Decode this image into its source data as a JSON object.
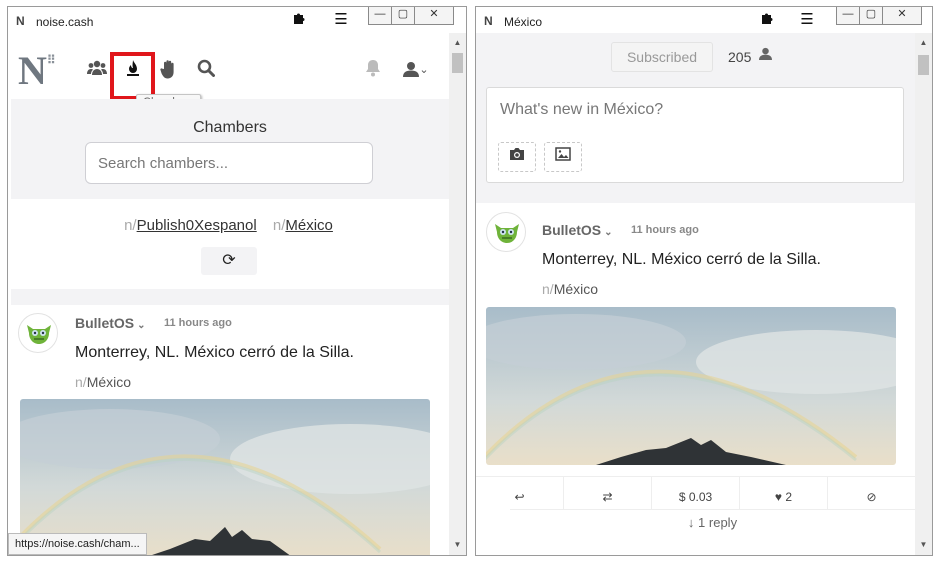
{
  "left_window": {
    "title": "noise.cash",
    "logo_char": "N",
    "extensions_icon": "puzzle-icon",
    "menu_glyph": "☰",
    "window_buttons": [
      "—",
      "▢",
      "✕"
    ],
    "nav": {
      "logo_text": "N",
      "tooltip": "Chambers",
      "icons": [
        "people-icon",
        "chambers-flame-icon",
        "hand-icon",
        "search-icon",
        "bell-icon",
        "user-icon"
      ]
    },
    "chambers": {
      "heading": "Chambers",
      "search_placeholder": "Search chambers...",
      "chips": [
        {
          "prefix": "n/",
          "name": "Publish0Xespanol"
        },
        {
          "prefix": "n/",
          "name": "México"
        }
      ],
      "refresh_glyph": "⟳"
    },
    "post": {
      "username": "BulletOS",
      "chevron": "⌄",
      "time": "11 hours ago",
      "text": "Monterrey, NL. México cerró de la Silla.",
      "chamber_prefix": "n/",
      "chamber": "México"
    },
    "status_url": "https://noise.cash/cham..."
  },
  "right_window": {
    "title": "México",
    "logo_char": "N",
    "menu_glyph": "☰",
    "window_buttons": [
      "—",
      "▢",
      "✕"
    ],
    "subscribed_label": "Subscribed",
    "subscriber_count": "205",
    "composer_placeholder": "What's new in México?",
    "post": {
      "username": "BulletOS",
      "chevron": "⌄",
      "time": "11 hours ago",
      "text": "Monterrey, NL. México cerró de la Silla.",
      "chamber_prefix": "n/",
      "chamber": "México"
    },
    "actions": {
      "reply_glyph": "↩",
      "repost_glyph": "⇄",
      "tip": "$ 0.03",
      "like_glyph": "♥",
      "likes": "2",
      "block_glyph": "⊘"
    },
    "replies_label": "1 reply",
    "replies_arrow": "↓"
  },
  "colors": {
    "highlight_box": "#e0161b",
    "panel_grey": "#f3f3f5"
  }
}
